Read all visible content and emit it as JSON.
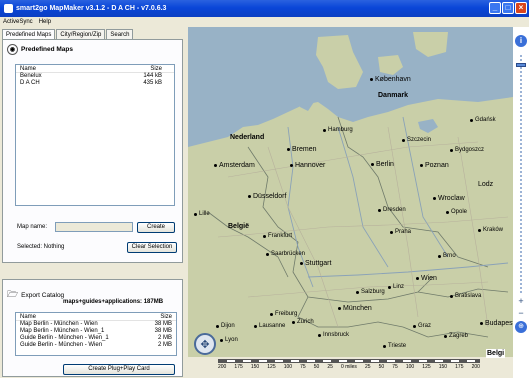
{
  "window": {
    "title": "smart2go MapMaker v3.1.2 - D A CH - v7.0.6.3"
  },
  "menu": [
    "ActiveSync",
    "Help"
  ],
  "tabs": [
    "Predefined Maps",
    "City/Region/Zip",
    "Search"
  ],
  "predefined": {
    "heading": "Predefined Maps",
    "col_name": "Name",
    "col_size": "Size",
    "rows": [
      {
        "name": "Benelux",
        "size": "144 kB"
      },
      {
        "name": "D A CH",
        "size": "435 kB"
      }
    ],
    "map_name_label": "Map name:",
    "create_button": "Create",
    "selected_label": "Selected: Nothing",
    "clear_button": "Clear Selection"
  },
  "export": {
    "heading": "Export Catalog",
    "summary": "maps+guides+applications: 187MB",
    "col_name": "Name",
    "col_size": "Size",
    "rows": [
      {
        "name": "Map Berlin - München - Wien",
        "size": "38 MB"
      },
      {
        "name": "Map Berlin - München - Wien_1",
        "size": "38 MB"
      },
      {
        "name": "Guide Berlin - München - Wien_1",
        "size": "2 MB"
      },
      {
        "name": "Guide Berlin - München - Wien",
        "size": "2 MB"
      }
    ],
    "create_card_button": "Create Plug+Play Card"
  },
  "map": {
    "colors": {
      "land": "#c9cfa8",
      "water": "#98b2c6",
      "border": "#6f7a6a",
      "road": "#b7b19c"
    },
    "cities": [
      {
        "name": "København",
        "big": true,
        "bold": false
      },
      {
        "name": "Danmark",
        "big": true,
        "bold": true
      },
      {
        "name": "Nederland",
        "big": true,
        "bold": true
      },
      {
        "name": "Bremen",
        "big": true,
        "bold": false
      },
      {
        "name": "Amsterdam",
        "big": true,
        "bold": false
      },
      {
        "name": "Hannover",
        "big": true,
        "bold": false
      },
      {
        "name": "Berlin",
        "big": true,
        "bold": false
      },
      {
        "name": "Poznan",
        "big": true,
        "bold": false
      },
      {
        "name": "Düsseldorf",
        "big": true,
        "bold": false
      },
      {
        "name": "Wroclaw",
        "big": true,
        "bold": false
      },
      {
        "name": "Lodz",
        "big": true,
        "bold": false
      },
      {
        "name": "België",
        "big": true,
        "bold": true
      },
      {
        "name": "Stuttgart",
        "big": true,
        "bold": false
      },
      {
        "name": "München",
        "big": true,
        "bold": false
      },
      {
        "name": "Wien",
        "big": true,
        "bold": false
      },
      {
        "name": "Budapest",
        "big": true,
        "bold": false
      },
      {
        "name": "Dijon",
        "big": false,
        "bold": false
      },
      {
        "name": "Lyon",
        "big": false,
        "bold": false
      },
      {
        "name": "Zürich",
        "big": false,
        "bold": false
      },
      {
        "name": "Innsbruck",
        "big": false,
        "bold": false
      },
      {
        "name": "Graz",
        "big": false,
        "bold": false
      },
      {
        "name": "Szczecin",
        "big": false,
        "bold": false
      },
      {
        "name": "Dresden",
        "big": false,
        "bold": false
      },
      {
        "name": "Praha",
        "big": false,
        "bold": false
      },
      {
        "name": "Brno",
        "big": false,
        "bold": false
      },
      {
        "name": "Linz",
        "big": false,
        "bold": false
      },
      {
        "name": "Salzburg",
        "big": false,
        "bold": false
      },
      {
        "name": "Trieste",
        "big": false,
        "bold": false
      },
      {
        "name": "Zagreb",
        "big": false,
        "bold": false
      },
      {
        "name": "Kraków",
        "big": false,
        "bold": false
      },
      {
        "name": "Bratislava",
        "big": false,
        "bold": false
      },
      {
        "name": "Gdańsk",
        "big": false,
        "bold": false
      },
      {
        "name": "Bydgoszcz",
        "big": false,
        "bold": false
      },
      {
        "name": "Opole",
        "big": false,
        "bold": false
      },
      {
        "name": "Frankfurt",
        "big": false,
        "bold": false
      },
      {
        "name": "Saarbrücken",
        "big": false,
        "bold": false
      },
      {
        "name": "Freiburg",
        "big": false,
        "bold": false
      },
      {
        "name": "Lausanne",
        "big": false,
        "bold": false
      },
      {
        "name": "Hamburg",
        "big": false,
        "bold": false
      },
      {
        "name": "Lille",
        "big": false,
        "bold": false
      },
      {
        "name": "Belgi",
        "big": true,
        "bold": true
      }
    ],
    "scale_labels": [
      "200",
      "175",
      "150",
      "125",
      "100",
      "75",
      "50",
      "25",
      "0 miles",
      "25",
      "50",
      "75",
      "100",
      "125",
      "150",
      "175",
      "200"
    ]
  }
}
